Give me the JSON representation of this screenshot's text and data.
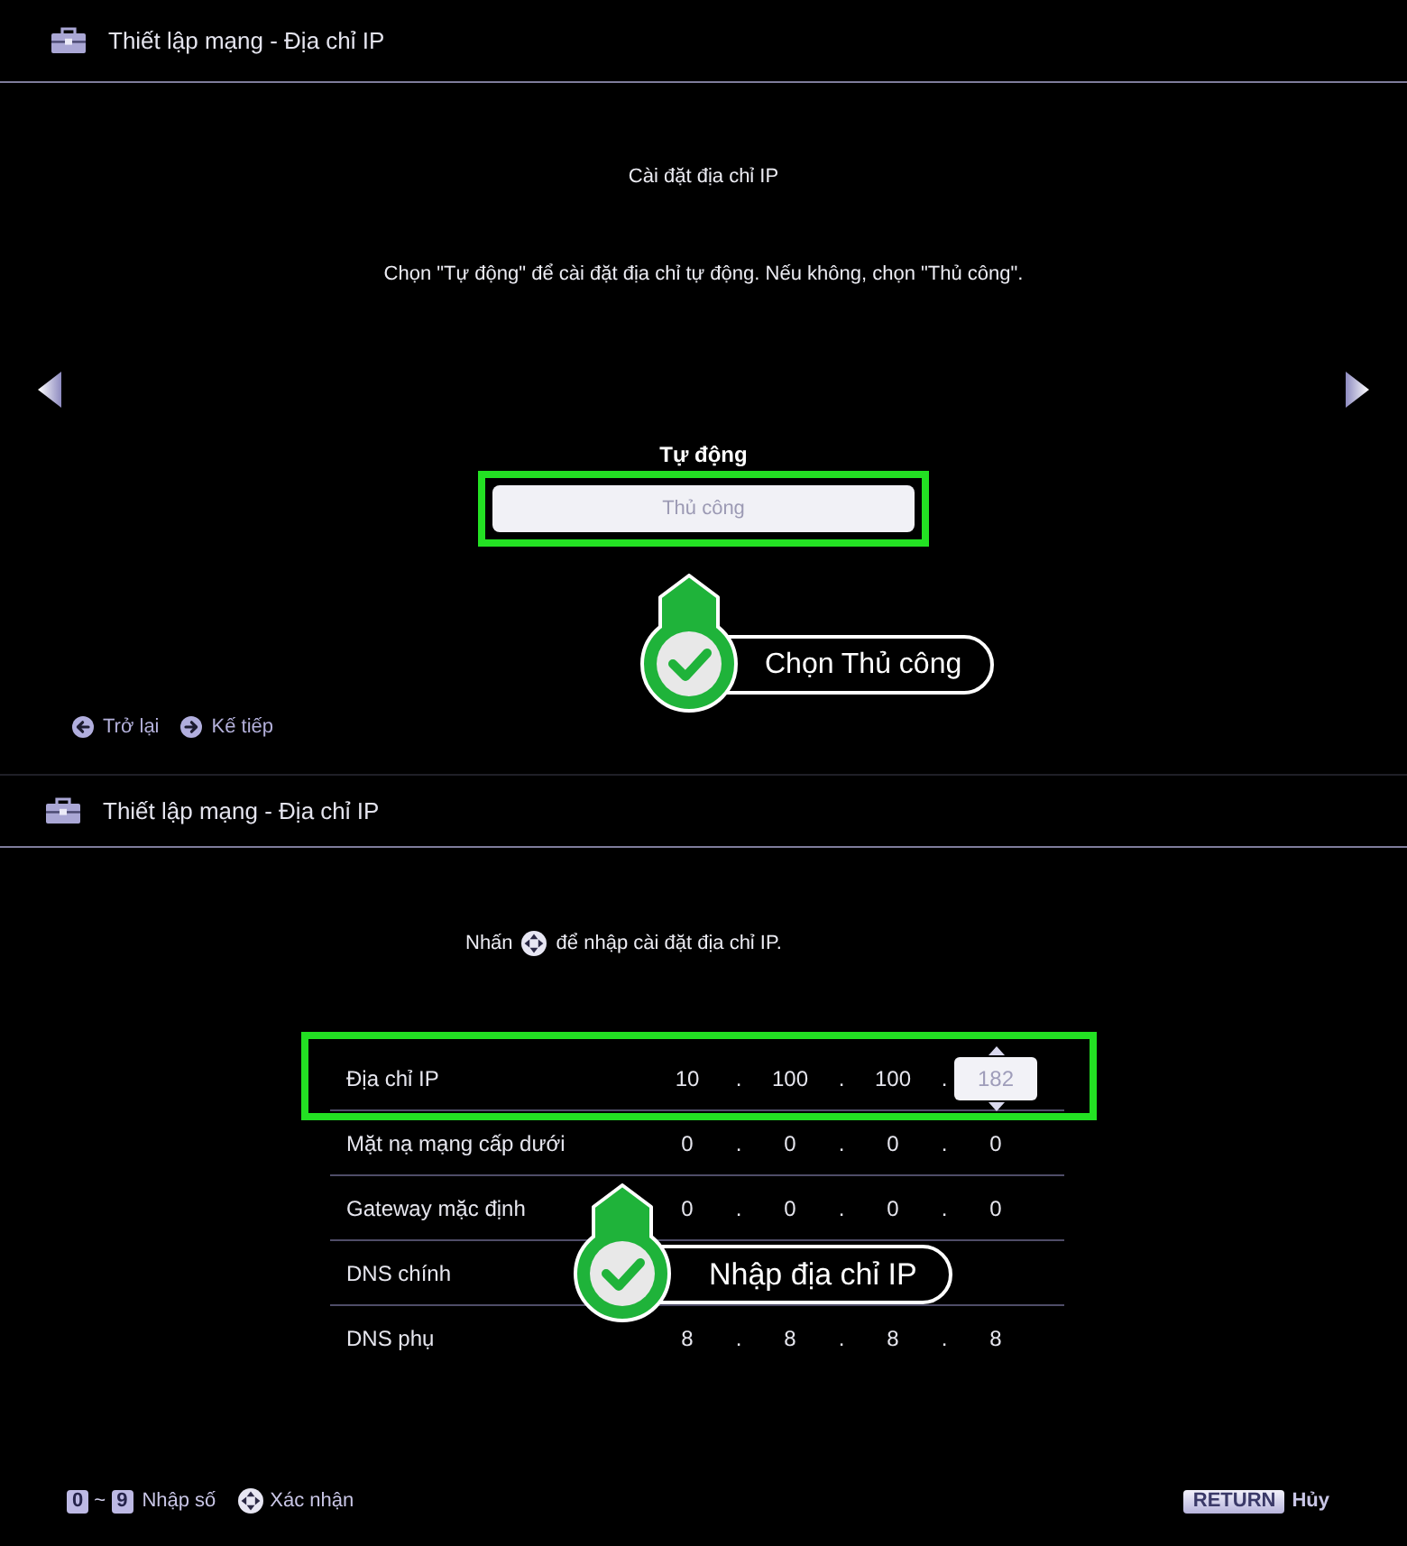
{
  "screens": [
    {
      "kind": "option_select",
      "title": "Thiết lập mạng - Địa chỉ IP",
      "heading": "Cài đặt địa chỉ IP",
      "instruction": "Chọn \"Tự động\" để cài đặt địa chỉ tự động. Nếu không, chọn \"Thủ công\".",
      "options": [
        {
          "label": "Tự động",
          "selected": false,
          "highlighted": false
        },
        {
          "label": "Thủ công",
          "selected": true,
          "highlighted": true
        }
      ],
      "callout": {
        "text": "Chọn Thủ công"
      },
      "nav": [
        {
          "kind": "back",
          "label": "Trở lại"
        },
        {
          "kind": "next",
          "label": "Kế tiếp"
        }
      ]
    },
    {
      "kind": "ip_form",
      "title": "Thiết lập mạng - Địa chỉ IP",
      "instruction": {
        "before": "Nhấn",
        "after": "để nhập cài đặt địa chỉ IP."
      },
      "table": {
        "separator": ".",
        "rows": [
          {
            "label": "Địa chỉ IP",
            "highlighted": true,
            "octets": [
              {
                "value": "10",
                "selected": false
              },
              {
                "value": "100",
                "selected": false
              },
              {
                "value": "100",
                "selected": false
              },
              {
                "value": "182",
                "selected": true
              }
            ]
          },
          {
            "label": "Mặt nạ mạng cấp dưới",
            "highlighted": false,
            "octets": [
              {
                "value": "0",
                "selected": false
              },
              {
                "value": "0",
                "selected": false
              },
              {
                "value": "0",
                "selected": false
              },
              {
                "value": "0",
                "selected": false
              }
            ]
          },
          {
            "label": "Gateway mặc định",
            "highlighted": false,
            "octets": [
              {
                "value": "0",
                "selected": false
              },
              {
                "value": "0",
                "selected": false
              },
              {
                "value": "0",
                "selected": false
              },
              {
                "value": "0",
                "selected": false
              }
            ]
          },
          {
            "label": "DNS chính",
            "highlighted": false
          },
          {
            "label": "DNS phụ",
            "highlighted": false,
            "octets": [
              {
                "value": "8",
                "selected": false
              },
              {
                "value": "8",
                "selected": false
              },
              {
                "value": "8",
                "selected": false
              },
              {
                "value": "8",
                "selected": false
              }
            ]
          }
        ]
      },
      "callout": {
        "text": "Nhập địa chỉ IP"
      },
      "hints": [
        {
          "kind": "key_range",
          "from": "0",
          "joiner": "~",
          "to": "9",
          "label": "Nhập số"
        },
        {
          "kind": "dpad",
          "label": "Xác nhận"
        }
      ],
      "return_hint": {
        "key": "RETURN",
        "label": "Hủy"
      }
    }
  ]
}
